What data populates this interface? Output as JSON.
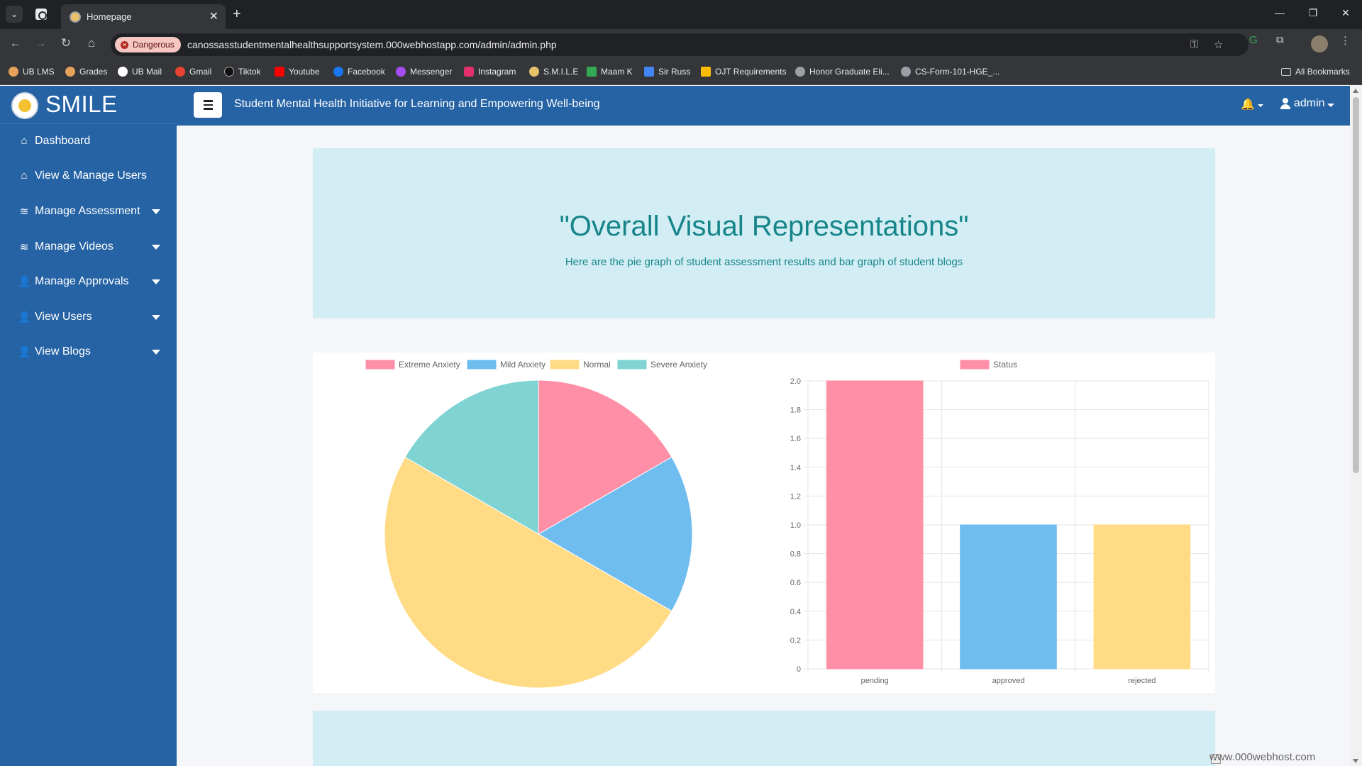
{
  "browser": {
    "tab_title": "Homepage",
    "security_label": "Dangerous",
    "url": "canossasstudentmentalhealthsupportsystem.000webhostapp.com/admin/admin.php",
    "bookmarks": [
      {
        "label": "UB LMS",
        "color": "#e6a15a"
      },
      {
        "label": "Grades",
        "color": "#e6a15a"
      },
      {
        "label": "UB Mail",
        "color": "#ffffff"
      },
      {
        "label": "Gmail",
        "color": "#ea4335"
      },
      {
        "label": "Tiktok",
        "color": "#111111"
      },
      {
        "label": "Youtube",
        "color": "#ff0000"
      },
      {
        "label": "Facebook",
        "color": "#1877f2"
      },
      {
        "label": "Messenger",
        "color": "#a64cf5"
      },
      {
        "label": "Instagram",
        "color": "#e1306c"
      },
      {
        "label": "S.M.I.L.E",
        "color": "#e8c26a"
      },
      {
        "label": "Maam K",
        "color": "#34a853"
      },
      {
        "label": "Sir Russ",
        "color": "#4285f4"
      },
      {
        "label": "OJT Requirements",
        "color": "#fbbc04"
      },
      {
        "label": "Honor Graduate Eli...",
        "color": "#9aa0a6"
      },
      {
        "label": "CS-Form-101-HGE_...",
        "color": "#9aa0a6"
      }
    ],
    "all_bookmarks": "All Bookmarks"
  },
  "sidebar": {
    "brand": "SMILE",
    "items": [
      {
        "label": "Dashboard",
        "icon": "home-icon",
        "has_caret": false
      },
      {
        "label": "View & Manage Users",
        "icon": "home-icon",
        "has_caret": false
      },
      {
        "label": "Manage Assessment",
        "icon": "layers-icon",
        "has_caret": true
      },
      {
        "label": "Manage Videos",
        "icon": "layers-icon",
        "has_caret": true
      },
      {
        "label": "Manage Approvals",
        "icon": "user-cog-icon",
        "has_caret": true
      },
      {
        "label": "View Users",
        "icon": "user-cog-icon",
        "has_caret": true
      },
      {
        "label": "View Blogs",
        "icon": "user-cog-icon",
        "has_caret": true
      }
    ]
  },
  "topnav": {
    "title": "Student Mental Health Initiative for Learning and Empowering Well-being",
    "user": "admin"
  },
  "hero": {
    "title": "\"Overall Visual Representations\"",
    "subtitle": "Here are the pie graph of student assessment results and bar graph of student blogs"
  },
  "chart_data": [
    {
      "type": "pie",
      "legend_position": "top",
      "labels": [
        "Extreme Anxiety",
        "Mild Anxiety",
        "Normal",
        "Severe Anxiety"
      ],
      "values": [
        1,
        1,
        3,
        1
      ],
      "colors": [
        "#ff8fa7",
        "#6fbcef",
        "#ffdb86",
        "#7fd3d3"
      ]
    },
    {
      "type": "bar",
      "legend_position": "top",
      "categories": [
        "pending",
        "approved",
        "rejected"
      ],
      "series": [
        {
          "name": "Status",
          "values": [
            2,
            1,
            1
          ]
        }
      ],
      "colors": [
        "#ff8fa7",
        "#6fbcef",
        "#ffdb86"
      ],
      "ylim": [
        0,
        2.0
      ],
      "yticks": [
        "0",
        "0.2",
        "0.4",
        "0.6",
        "0.8",
        "1.0",
        "1.2",
        "1.4",
        "1.6",
        "1.8",
        "2.0"
      ],
      "grid": true
    }
  ],
  "footer": {
    "host_badge": "www.000webhost.com"
  }
}
